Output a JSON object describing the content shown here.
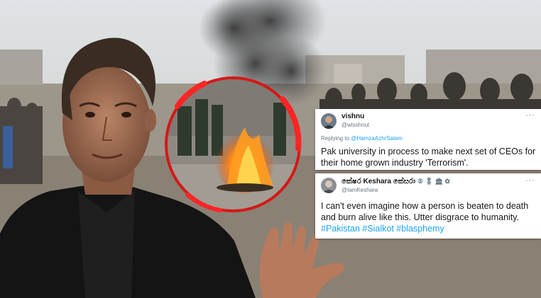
{
  "tweets": [
    {
      "display_name": "vishnu",
      "handle": "@wisshnut",
      "replying_prefix": "Replying to",
      "replying_to": "@HamzaAzhrSalam",
      "text": "Pak university in process to make next set of CEOs for their home grown industry 'Terrorism'.",
      "more_icon": "more-dots-icon"
    },
    {
      "display_name": "කේෂර Keshara කේසරා",
      "name_suffix": "⑤ 🎖 🏛 ✿",
      "handle": "@IamKeshara",
      "text": "I can't even imagine how a person is beaten to death and burn alive like this. Utter disgrace to humanity.",
      "hashtags": "#Pakistan #Sialkot #blasphemy",
      "more_icon": "more-dots-icon"
    }
  ],
  "colors": {
    "highlight_ring": "#e01010",
    "link": "#1da1f2",
    "tweet_bg": "#ffffff"
  }
}
